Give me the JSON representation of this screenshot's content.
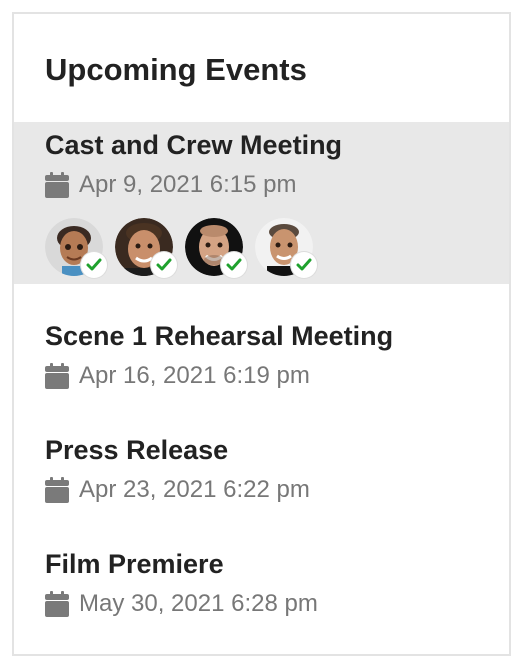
{
  "widget": {
    "title": "Upcoming Events"
  },
  "events": [
    {
      "title": "Cast and Crew Meeting",
      "date": "Apr 9, 2021 6:15 pm",
      "attendees": [
        {
          "name": "attendee-1",
          "confirmed": true
        },
        {
          "name": "attendee-2",
          "confirmed": true
        },
        {
          "name": "attendee-3",
          "confirmed": true
        },
        {
          "name": "attendee-4",
          "confirmed": true
        }
      ]
    },
    {
      "title": "Scene 1 Rehearsal Meeting",
      "date": "Apr 16, 2021 6:19 pm"
    },
    {
      "title": "Press Release",
      "date": "Apr 23, 2021 6:22 pm"
    },
    {
      "title": "Film Premiere",
      "date": "May 30, 2021 6:28 pm"
    }
  ],
  "icons": {
    "date": "calendar-icon",
    "confirmed": "check-icon"
  },
  "colors": {
    "highlight": "#e8e8e8",
    "check": "#1fa12e",
    "muted_text": "#777777",
    "title_text": "#222222"
  }
}
